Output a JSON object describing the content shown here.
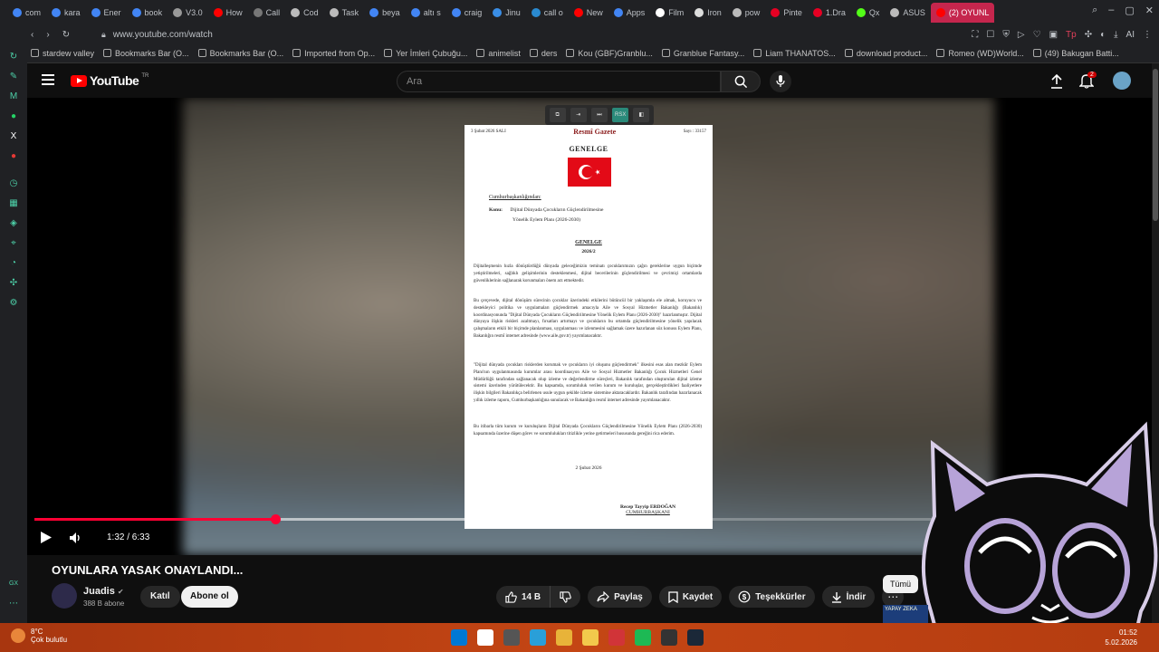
{
  "browser": {
    "tabs": [
      {
        "label": "com",
        "color": "#4285f4"
      },
      {
        "label": "kara",
        "color": "#4285f4"
      },
      {
        "label": "Ener",
        "color": "#4285f4"
      },
      {
        "label": "book",
        "color": "#4285f4"
      },
      {
        "label": "V3.0",
        "color": "#999999"
      },
      {
        "label": "How",
        "color": "#ff0000"
      },
      {
        "label": "Call",
        "color": "#777777"
      },
      {
        "label": "Cod",
        "color": "#bbbbbb"
      },
      {
        "label": "Task",
        "color": "#bbbbbb"
      },
      {
        "label": "beya",
        "color": "#4285f4"
      },
      {
        "label": "altı s",
        "color": "#4285f4"
      },
      {
        "label": "craig",
        "color": "#4285f4"
      },
      {
        "label": "Jinu",
        "color": "#3a8ee6"
      },
      {
        "label": "call o",
        "color": "#2a8ad0"
      },
      {
        "label": "New",
        "color": "#ff0000"
      },
      {
        "label": "Apps",
        "color": "#4285f4"
      },
      {
        "label": "Film",
        "color": "#ffffff"
      },
      {
        "label": "Iron",
        "color": "#dddddd"
      },
      {
        "label": "pow",
        "color": "#bbbbbb"
      },
      {
        "label": "Pinte",
        "color": "#e60023"
      },
      {
        "label": "1.Dra",
        "color": "#e60023"
      },
      {
        "label": "Qx",
        "color": "#53fc18"
      },
      {
        "label": "ASUS",
        "color": "#bbbbbb"
      },
      {
        "label": "(2) OYUNL",
        "color": "#ff0000",
        "active": true
      }
    ],
    "address": {
      "url": "www.youtube.com/watch"
    },
    "bookmarks": [
      "stardew valley",
      "Bookmarks Bar (O...",
      "Bookmarks Bar (O...",
      "Imported from Op...",
      "Yer İmleri Çubuğu...",
      "animelist",
      "ders",
      "Kou (GBF)Granblu...",
      "Granblue Fantasy...",
      "Liam THANATOS...",
      "download product...",
      "Romeo (WD)World...",
      "(49) Bakugan Batti..."
    ]
  },
  "youtube": {
    "logo_text": "YouTube",
    "country_code": "TR",
    "search_placeholder": "Ara",
    "notification_count": "2"
  },
  "video": {
    "overlay_tool_label": "RSX",
    "document": {
      "date_line": "3 Şubat 2026 SALI",
      "publication": "Resmî Gazete",
      "issue": "Sayı : 33157",
      "heading": "GENELGE",
      "from": "Cumhurbaşkanlığından:",
      "subject_label": "Konu:",
      "subject_line1": "Dijital Dünyada Çocukların Güçlendirilmesine",
      "subject_line2": "Yönelik Eylem Planı (2026-2030)",
      "heading2": "GENELGE",
      "number": "2026/2",
      "p1": "Dijitalleşmenin hızla dönüştürdüğü dünyada geleceğimizin teminatı çocuklarımızın çağın gereklerine uygun biçimde yetiştirilmeleri, sağlıklı gelişimlerinin desteklenmesi, dijital becerilerinin güçlendirilmesi ve çevrimiçi ortamlarda güvenliklerinin sağlanarak korunmaları önem arz etmektedir.",
      "p2": "Bu çerçevede, dijital dönüşüm sürecinin çocuklar üzerindeki etkilerini bütüncül bir yaklaşımla ele almak, koruyucu ve destekleyici politika ve uygulamaları güçlendirmek amacıyla Aile ve Sosyal Hizmetler Bakanlığı (Bakanlık) koordinasyonunda \"Dijital Dünyada Çocukların Güçlendirilmesine Yönelik Eylem Planı (2026-2030)\" hazırlanmıştır. Dijital dünyaya ilişkin riskleri azaltmayı, fırsatları artırmayı ve çocukların bu ortamda güçlendirilmesine yönelik yapılacak çalışmaların etkili bir biçimde planlanması, uygulanması ve izlenmesini sağlamak üzere hazırlanan söz konusu Eylem Planı, Bakanlığın resmî internet adresinde (www.aile.gov.tr) yayımlanacaktır.",
      "p3": "\"Dijital dünyada çocukları risklerden korumak ve çocukların iyi oluşunu güçlendirmek\" ilkesini esas alan mezkûr Eylem Planı'nın uygulanmasında kurumlar arası koordinasyon Aile ve Sosyal Hizmetler Bakanlığı Çocuk Hizmetleri Genel Müdürlüğü tarafından sağlanacak olup izleme ve değerlendirme süreçleri, Bakanlık tarafından oluşturulan dijital izleme sistemi üzerinden yürütülecektir. Bu kapsamda, sorumluluk verilen kurum ve kuruluşlar, gerçekleştirdikleri faaliyetlere ilişkin bilgileri Bakanlıkça belirlenen usule uygun şekilde izleme sistemine aktaracaklardır. Bakanlık tarafından hazırlanacak yıllık izleme raporu, Cumhurbaşkanlığına sunulacak ve Bakanlığın resmî internet adresinde yayımlanacaktır.",
      "p4": "Bu itibarla tüm kurum ve kuruluşların Dijital Dünyada Çocukların Güçlendirilmesine Yönelik Eylem Planı (2026-2030) kapsamında üzerine düşen görev ve sorumlulukları titizlikle yerine getirmeleri hususunda gereğini rica ederim.",
      "date": "2 Şubat 2026",
      "signer": "Recep Tayyip ERDOĞAN",
      "signer_title": "CUMHURBAŞKANI"
    },
    "time_display": "1:32 / 6:33",
    "progress_fraction": 0.2335,
    "buffered_fraction": 0.57,
    "title": "OYUNLARA YASAK ONAYLANDI...",
    "channel": {
      "name": "Juadis",
      "subscribers": "388 B abone",
      "join_label": "Katıl",
      "subscribe_label": "Abone ol"
    },
    "actions": {
      "likes": "14 B",
      "share": "Paylaş",
      "save": "Kaydet",
      "thanks": "Teşekkürler",
      "download": "İndir"
    },
    "filter_chip": "Tümü",
    "sidebar_thumb_label": "YAPAY ZEKA"
  },
  "taskbar": {
    "temperature": "8°C",
    "weather_desc": "Çok bulutlu",
    "time": "01:52",
    "date": "5.02.2026",
    "icon_colors": [
      "#0078d4",
      "#ffffff",
      "#555555",
      "#2a9fd8",
      "#e8b339",
      "#f2c94c",
      "#d13438",
      "#1db954",
      "#333333",
      "#1b2838"
    ]
  },
  "colors": {
    "youtube_red": "#ff0000",
    "progress_red": "#ff0033",
    "active_tab": "#c5264d"
  }
}
